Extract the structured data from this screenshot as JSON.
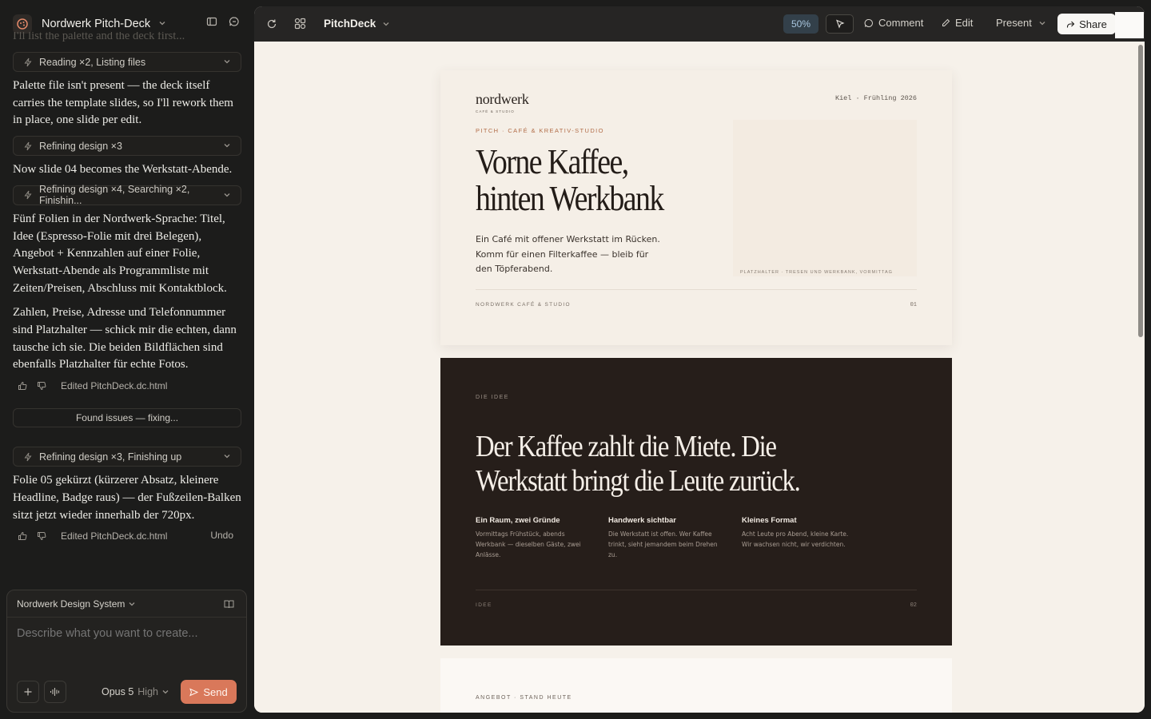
{
  "sidebar": {
    "project_title": "Nordwerk Pitch-Deck",
    "faded_text": "I'll list the palette and the deck first...",
    "chat": {
      "tool_reading": "Reading ×2, Listing files",
      "msg_palette": "Palette file isn't present — the deck itself carries the template slides, so I'll rework them in place, one slide per edit.",
      "tool_refining1": "Refining design ×3",
      "msg_slide04": "Now slide 04 becomes the Werkstatt-Abende.",
      "tool_refining2": "Refining design ×4, Searching ×2, Finishin...",
      "msg_fuenf": "Fünf Folien in der Nordwerk-Sprache: Titel, Idee (Espresso-Folie mit drei Belegen), Angebot + Kennzahlen auf einer Folie, Werkstatt-Abende als Programmliste mit Zeiten/Preisen, Abschluss mit Kontaktblock.",
      "msg_zahlen": "Zahlen, Preise, Adresse und Telefonnummer sind Platzhalter — schick mir die echten, dann tausche ich sie. Die beiden Bildflächen sind ebenfalls Platzhalter für echte Fotos.",
      "edited1": "Edited PitchDeck.dc.html",
      "status_found": "Found issues — fixing...",
      "tool_refining3": "Refining design ×3, Finishing up",
      "msg_folie05": "Folie 05 gekürzt (kürzerer Absatz, kleinere Headline, Badge raus) — der Fußzeilen-Balken sitzt jetzt wieder innerhalb der 720px.",
      "edited2": "Edited PitchDeck.dc.html",
      "undo": "Undo"
    },
    "composer": {
      "design_system": "Nordwerk Design System",
      "placeholder": "Describe what you want to create...",
      "model": "Opus 5",
      "level": "High",
      "send": "Send"
    }
  },
  "topbar": {
    "doc_name": "PitchDeck",
    "zoom": "50%",
    "comment": "Comment",
    "edit": "Edit",
    "present": "Present",
    "share": "Share"
  },
  "slides": {
    "s1": {
      "brand": "nordwerk",
      "brand_sub": "CAFÉ & STUDIO",
      "location": "Kiel · Frühling 2026",
      "kicker": "PITCH · CAFÉ & KREATIV-STUDIO",
      "headline_1": "Vorne Kaffee,",
      "headline_2": "hinten Werkbank",
      "body": "Ein Café mit offener Werkstatt im Rücken. Komm für einen Filterkaffee — bleib für den Töpferabend.",
      "image_caption": "PLATZHALTER · TRESEN UND WERKBANK, VORMITTAG",
      "footer": "NORDWERK CAFÉ & STUDIO",
      "number": "01"
    },
    "s2": {
      "kicker": "DIE IDEE",
      "headline_1": "Der Kaffee zahlt die Miete. Die",
      "headline_2": "Werkstatt bringt die Leute zurück.",
      "columns": [
        {
          "title": "Ein Raum, zwei Gründe",
          "text": "Vormittags Frühstück, abends Werkbank — dieselben Gäste, zwei Anlässe."
        },
        {
          "title": "Handwerk sichtbar",
          "text": "Die Werkstatt ist offen. Wer Kaffee trinkt, sieht jemandem beim Drehen zu."
        },
        {
          "title": "Kleines Format",
          "text": "Acht Leute pro Abend, kleine Karte. Wir wachsen nicht, wir verdichten."
        }
      ],
      "footer": "IDEE",
      "number": "02"
    },
    "s3": {
      "kicker": "ANGEBOT · STAND HEUTE"
    }
  },
  "colors": {
    "accent": "#d9785a",
    "slide_dark": "#261e1a",
    "slide_light": "#f5efe7",
    "kicker": "#b26d48"
  }
}
